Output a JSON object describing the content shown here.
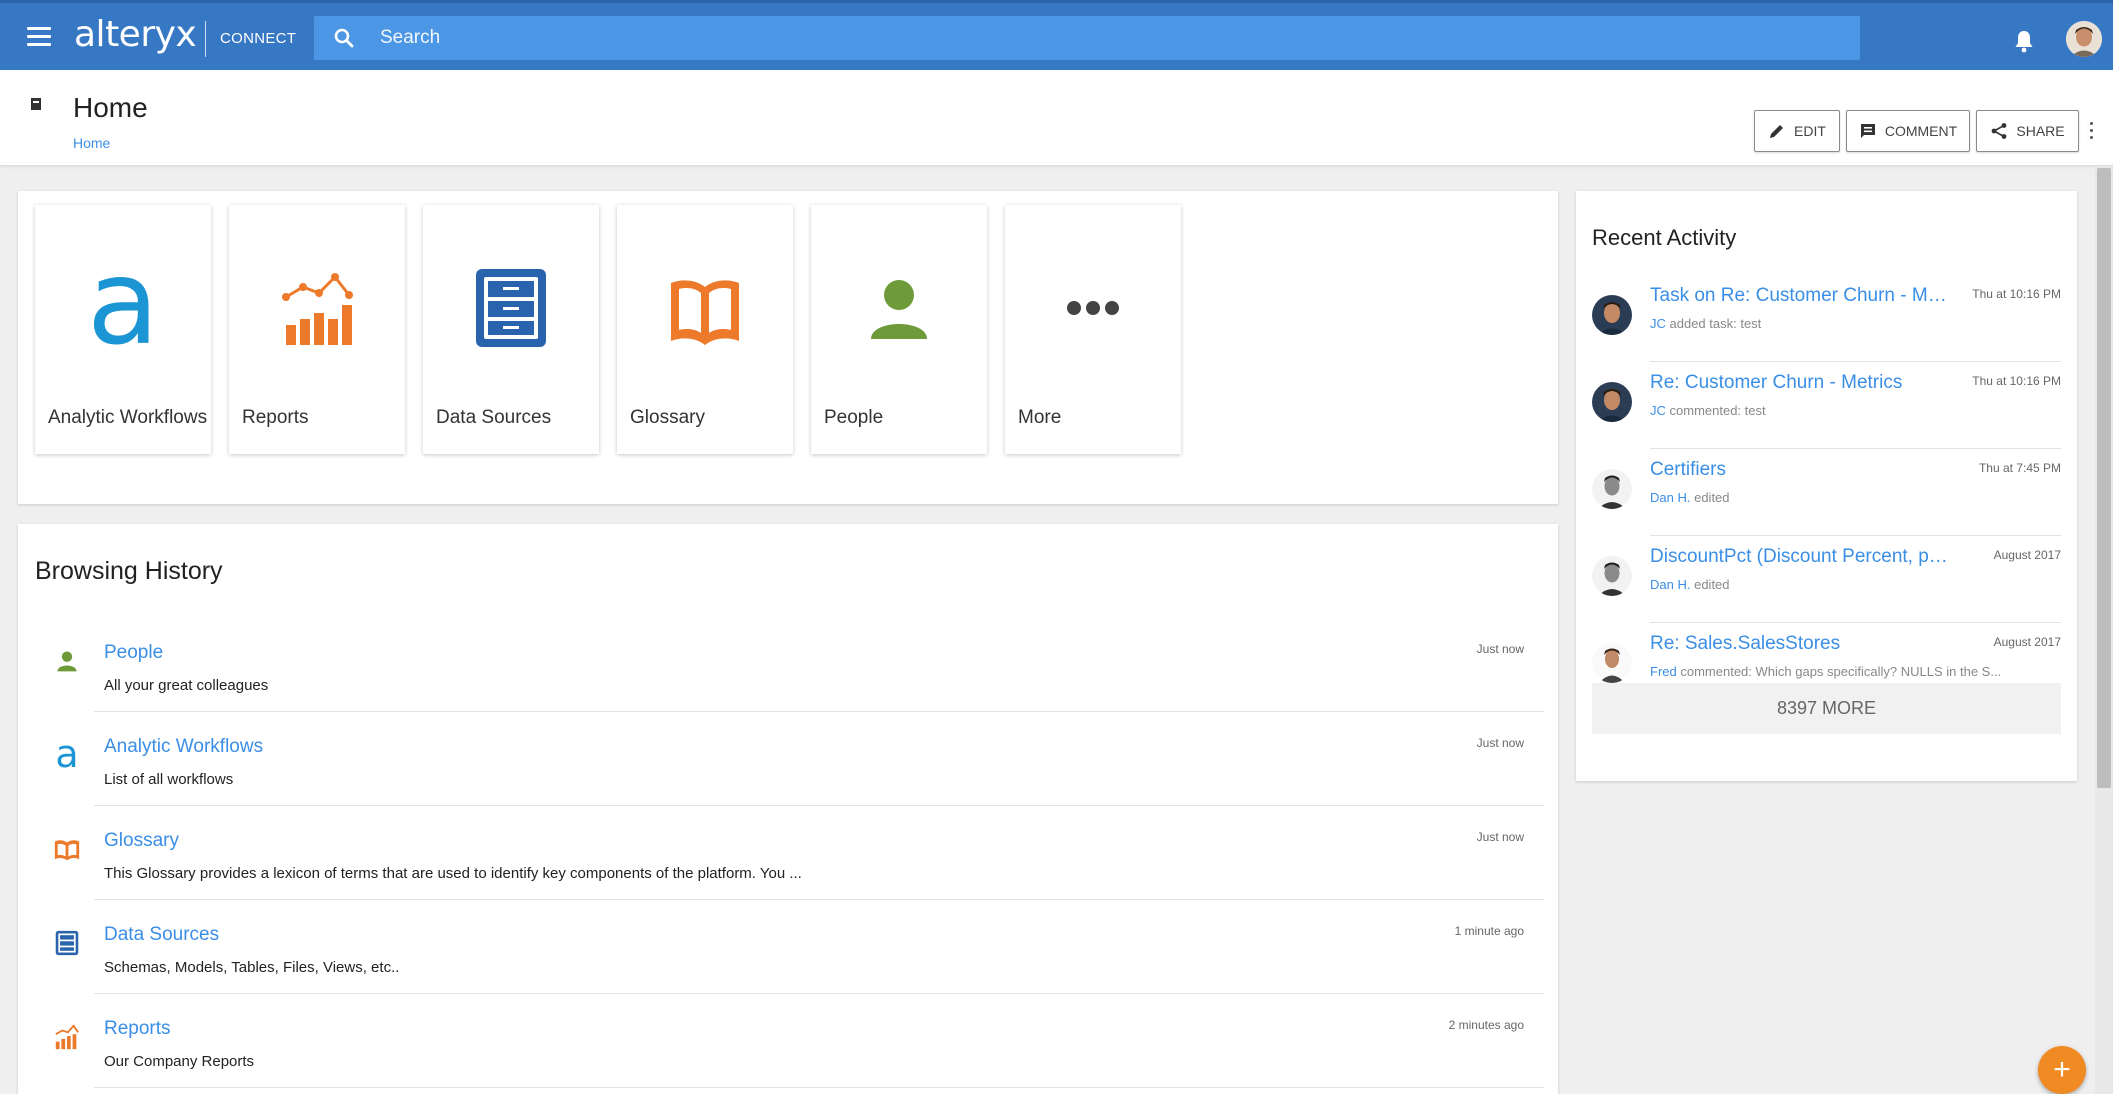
{
  "header": {
    "logo": "alteryx",
    "logo_sub": "CONNECT",
    "search_placeholder": "Search",
    "icons": [
      "menu-icon",
      "search-icon",
      "bell-icon",
      "user-avatar"
    ],
    "colors": {
      "bar": "#3678c3",
      "search": "#4b97e6"
    }
  },
  "page": {
    "title": "Home",
    "breadcrumb": "Home",
    "buttons": {
      "edit": "EDIT",
      "comment": "COMMENT",
      "share": "SHARE"
    }
  },
  "tiles": [
    {
      "label": "Analytic Workflows",
      "icon": "alteryx-a-icon",
      "color": "#1b95d3"
    },
    {
      "label": "Reports",
      "icon": "reports-chart-icon",
      "color": "#ec7a2a"
    },
    {
      "label": "Data Sources",
      "icon": "file-cabinet-icon",
      "color": "#2a63ad"
    },
    {
      "label": "Glossary",
      "icon": "open-book-icon",
      "color": "#ec7a2a"
    },
    {
      "label": "People",
      "icon": "person-icon",
      "color": "#6f9a3a"
    },
    {
      "label": "More",
      "icon": "ellipsis-icon",
      "color": "#444444"
    }
  ],
  "history": {
    "title": "Browsing History",
    "items": [
      {
        "title": "People",
        "desc": "All your great colleagues",
        "time": "Just now",
        "icon": "person-icon"
      },
      {
        "title": "Analytic Workflows",
        "desc": "List of all workflows",
        "time": "Just now",
        "icon": "alteryx-a-icon"
      },
      {
        "title": "Glossary",
        "desc": "This Glossary provides a lexicon of terms that are used to identify key components of the platform. You ...",
        "time": "Just now",
        "icon": "open-book-icon"
      },
      {
        "title": "Data Sources",
        "desc": "Schemas, Models, Tables, Files, Views, etc..",
        "time": "1 minute ago",
        "icon": "file-cabinet-icon"
      },
      {
        "title": "Reports",
        "desc": "Our Company Reports",
        "time": "2 minutes ago",
        "icon": "reports-chart-icon"
      }
    ]
  },
  "activity": {
    "title": "Recent Activity",
    "items": [
      {
        "title": "Task on Re: Customer Churn - Metr...",
        "user": "JC",
        "action": "added task: test",
        "time": "Thu at 10:16 PM"
      },
      {
        "title": "Re: Customer Churn - Metrics",
        "user": "JC",
        "action": "commented: test",
        "time": "Thu at 10:16 PM"
      },
      {
        "title": "Certifiers",
        "user": "Dan H.",
        "action": "edited",
        "time": "Thu at 7:45 PM"
      },
      {
        "title": "DiscountPct (Discount Percent, perc...",
        "user": "Dan H.",
        "action": "edited",
        "time": "August 2017"
      },
      {
        "title": "Re: Sales.SalesStores",
        "user": "Fred",
        "action": "commented: Which gaps specifically? NULLS in the S...",
        "time": "August 2017"
      }
    ],
    "more": "8397 MORE"
  },
  "fab": "+"
}
